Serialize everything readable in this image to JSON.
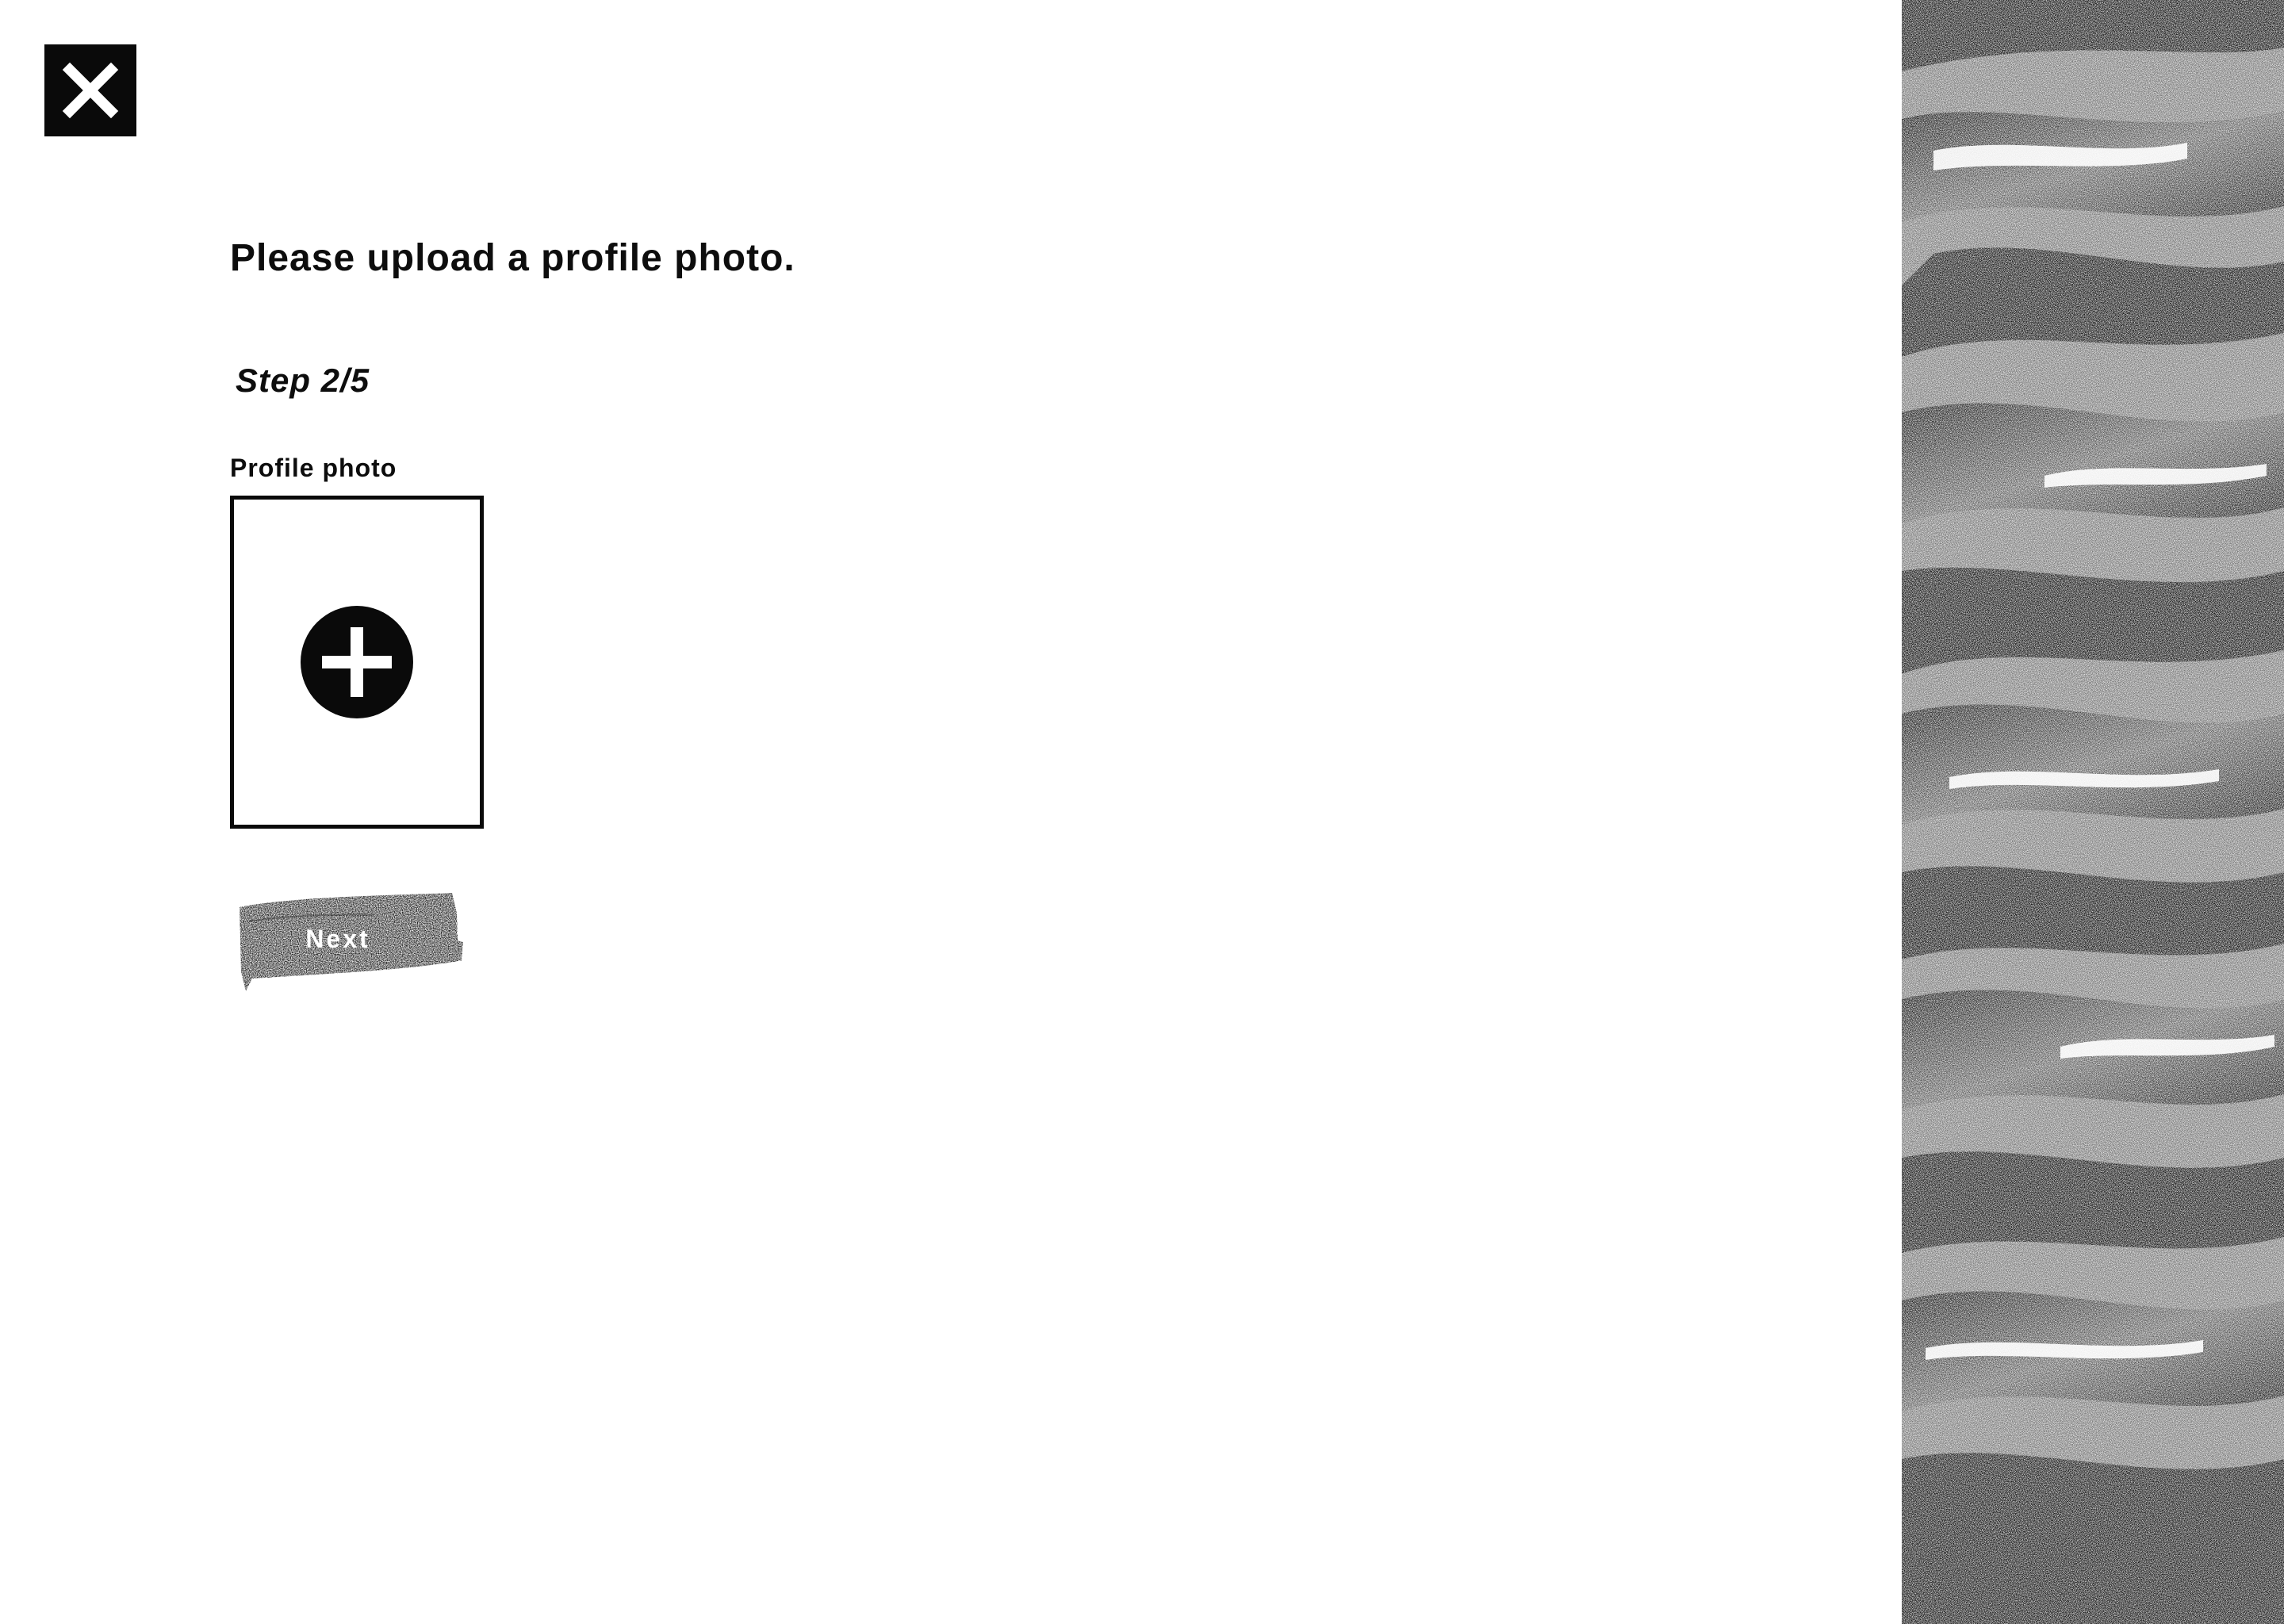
{
  "close": {
    "icon": "close-icon"
  },
  "form": {
    "title": "Please upload a profile photo.",
    "step": "Step 2/5",
    "photo_label": "Profile photo",
    "upload_icon": "plus-circle-icon"
  },
  "actions": {
    "next_label": "Next"
  },
  "decoration": {
    "art": "stippled-brushstrokes-image"
  },
  "colors": {
    "background": "#ffffff",
    "ink": "#0a0a0a"
  }
}
